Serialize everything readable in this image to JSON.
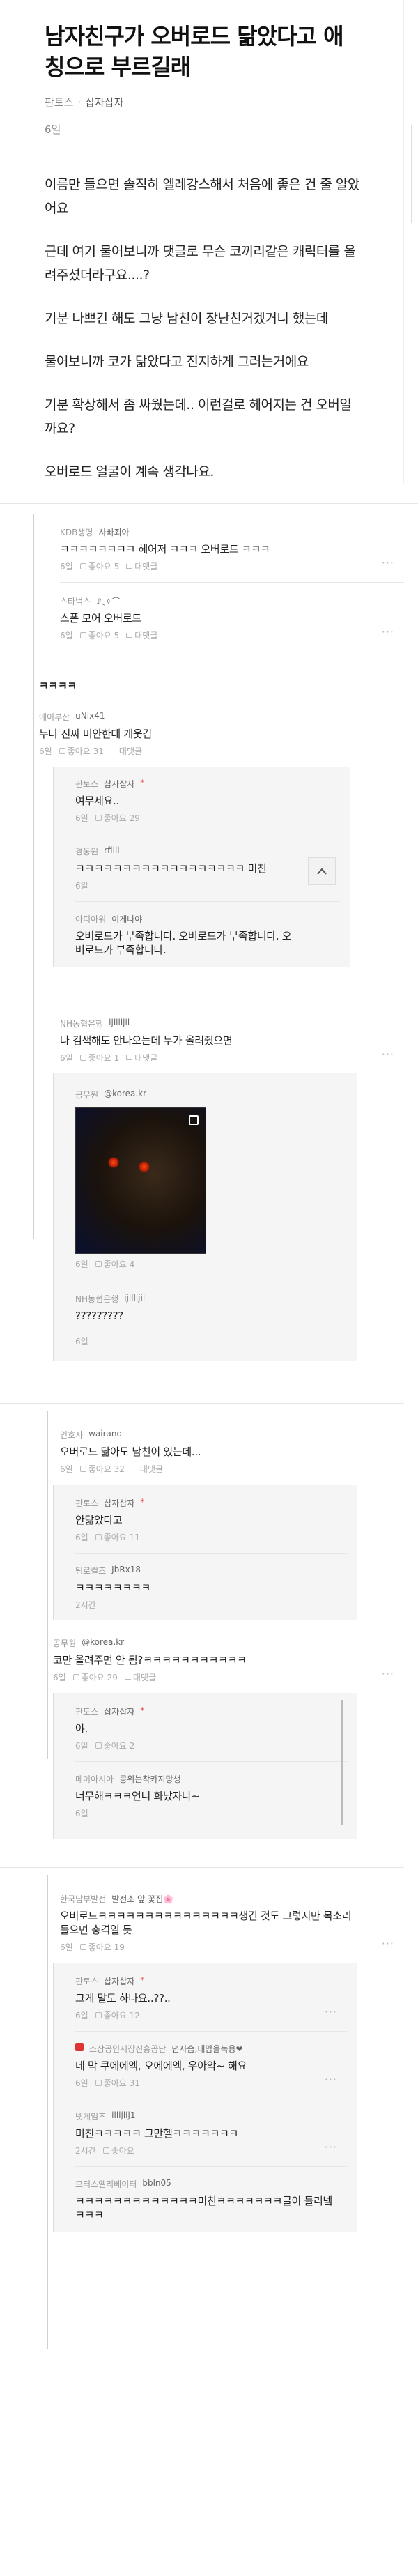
{
  "post": {
    "title": "남자친구가 오버로드 닮았다고 애칭으로 부르길래",
    "meta_a": "판토스",
    "meta_b": "삽자삽자",
    "date": "6일",
    "body": [
      "이름만 들으면 솔직히 엘레강스해서 처음에 좋은 건 줄 알았어요",
      "근데 여기 물어보니까 댓글로 무슨 코끼리같은 캐릭터를 올려주셨더라구요....?",
      "기분 나쁘긴 해도 그냥 남친이 장난친거겠거니 했는데",
      "물어보니까 코가 닮았다고 진지하게 그러는거에요",
      "기분 확상해서 좀 싸웠는데.. 이런걸로 헤어지는 건 오버일까요?",
      "오버로드 얼굴이 계속 생각나요."
    ]
  },
  "labels": {
    "like": "좋아요",
    "reply": "대댓글",
    "dots": "···"
  },
  "comments": [
    {
      "org": "KDB생명",
      "user": "사빠죄아",
      "text": "ㅋㅋㅋㅋㅋㅋㅋㅋ 헤어저 ㅋㅋㅋ 오버로드 ㅋㅋㅋ",
      "date": "6일",
      "likes": "좋아요 5"
    },
    {
      "org": "스타벅스",
      "user": "♪◟✧⌒",
      "text": "스폰 모어 오버로드",
      "date": "6일",
      "likes": "좋아요 5"
    },
    {
      "org": "",
      "user": "",
      "text": "ㅋㅋㅋㅋ",
      "date": "",
      "likes": ""
    },
    {
      "org": "에이부산",
      "user": "uNix41",
      "text": "누나 진짜 미안한데 개웃김",
      "date": "6일",
      "likes": "좋아요 31"
    },
    {
      "org": "판토스",
      "user": "삽자삽자",
      "op": "*",
      "text": "여무세요..",
      "date": "6일",
      "likes": "좋아요 29"
    },
    {
      "org": "경동원",
      "user": "rfilli",
      "text": "ㅋㅋㅋㅋㅋㅋㅋㅋㅋㅋㅋㅋㅋㅋㅋㅋㅋㅋ 미친",
      "date": "6일",
      "likes": ""
    },
    {
      "org": "아디아워",
      "user": "이게나야",
      "text": "오버로드가 부족합니다. 오버로드가 부족합니다. 오버로드가 부족합니다.",
      "date": "",
      "likes": ""
    },
    {
      "org": "NH농협은행",
      "user": "ijlllijil",
      "text": "나 검색해도 안나오는데 누가 올려줬으면",
      "date": "6일",
      "likes": "좋아요 1"
    },
    {
      "org": "공무원",
      "user": "@korea.kr",
      "text": "",
      "date": "6일",
      "likes": "좋아요 4"
    },
    {
      "org": "NH농협은행",
      "user": "ijlllijil",
      "text": "?????????",
      "date": "6일",
      "likes": ""
    },
    {
      "org": "인호사",
      "user": "wairano",
      "text": "오버로드 닮아도 남친이 있는데...",
      "date": "6일",
      "likes": "좋아요 32"
    },
    {
      "org": "판토스",
      "user": "삽자삽자",
      "op": "*",
      "text": "안닮았다고",
      "date": "6일",
      "likes": "좋아요 11"
    },
    {
      "org": "팀로컬즈",
      "user": "JbRx18",
      "text": "ㅋㅋㅋㅋㅋㅋㅋㅋ",
      "date": "2시간",
      "likes": ""
    },
    {
      "org": "공무원",
      "user": "@korea.kr",
      "text": "코만 올려주면 안 됨?ㅋㅋㅋㅋㅋㅋㅋㅋㅋㅋㅋ",
      "date": "6일",
      "likes": "좋아요 29"
    },
    {
      "org": "판토스",
      "user": "삽자삽자",
      "op": "*",
      "text": "야.",
      "date": "6일",
      "likes": "좋아요 2"
    },
    {
      "org": "메이아시아",
      "user": "콩위는착카지망생",
      "text": "너무해ㅋㅋㅋ언니 화났자나~",
      "date": "6일",
      "likes": ""
    },
    {
      "org": "한국남부발전",
      "user": "발전소 앞 꽃집🌸",
      "text": "오버로드ㅋㅋㅋㅋㅋㅋㅋㅋㅋㅋㅋㅋㅋㅋㅋ생긴 것도 그렇지만 목소리 들으면 충격일 듯",
      "date": "6일",
      "likes": "좋아요 19"
    },
    {
      "org": "판토스",
      "user": "삽자삽자",
      "op": "*",
      "text": "그게 말도 하나요..??..",
      "date": "6일",
      "likes": "좋아요 12"
    },
    {
      "org": "소상공인시장진흥공단",
      "user": "넌사슴,내맘을녹용❤",
      "text": "네 막 쿠에에엑, 오에에엑, 우아악~ 해요",
      "date": "6일",
      "likes": "좋아요 31"
    },
    {
      "org": "넷게임즈",
      "user": "illijllj1",
      "text": "미친ㅋㅋㅋㅋㅋ 그만헬ㅋㅋㅋㅋㅋㅋㅋ",
      "date": "2시간",
      "likes": "좋아요"
    },
    {
      "org": "모터스엘리베이터",
      "user": "bbln05",
      "text": "ㅋㅋㅋㅋㅋㅋㅋㅋㅋㅋㅋㅋㅋ미친ㅋㅋㅋㅋㅋㅋㅋ글이 들리넼ㅋㅋㅋ",
      "date": "",
      "likes": ""
    }
  ]
}
